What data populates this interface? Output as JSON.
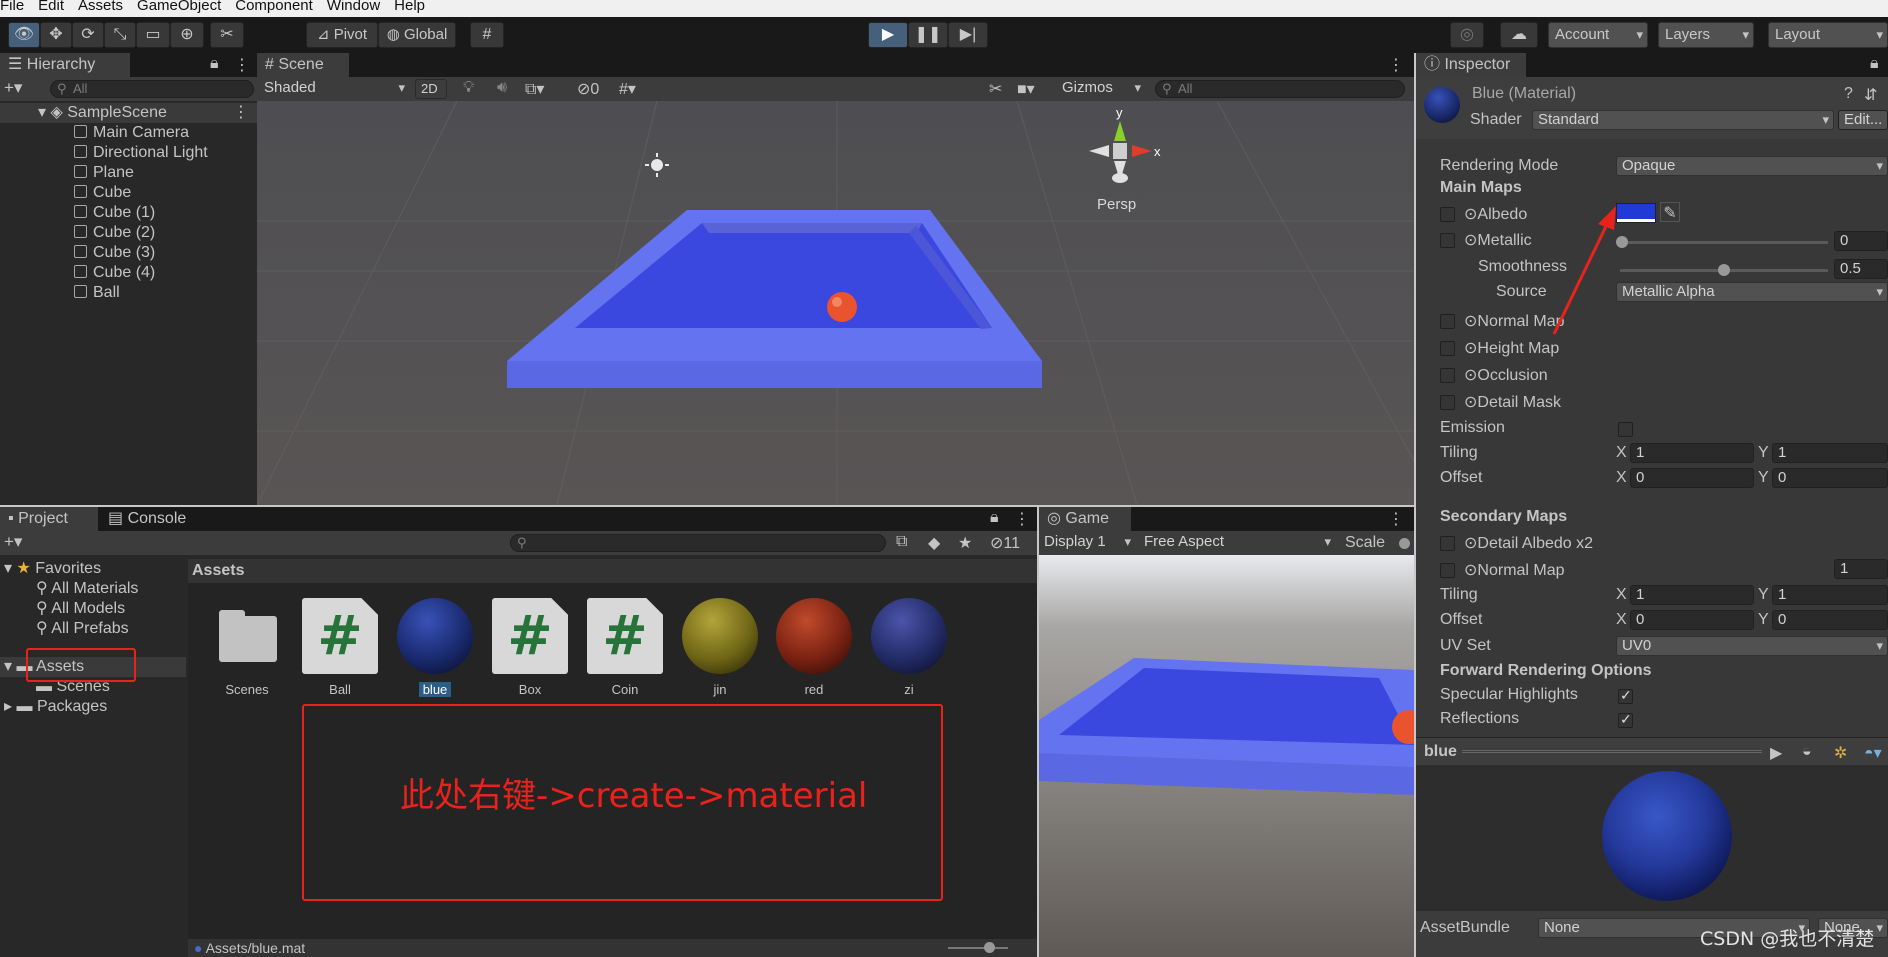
{
  "menu": [
    "File",
    "Edit",
    "Assets",
    "GameObject",
    "Component",
    "Window",
    "Help"
  ],
  "toolbar": {
    "pivot": "Pivot",
    "global": "Global",
    "account": "Account",
    "layers": "Layers",
    "layout": "Layout"
  },
  "hierarchy": {
    "tab": "Hierarchy",
    "search_placeholder": "All",
    "scene": "SampleScene",
    "items": [
      "Main Camera",
      "Directional Light",
      "Plane",
      "Cube",
      "Cube (1)",
      "Cube (2)",
      "Cube (3)",
      "Cube (4)",
      "Ball"
    ]
  },
  "scene": {
    "tab": "Scene",
    "shading": "Shaded",
    "mode2d": "2D",
    "hidden_count": "0",
    "gizmos": "Gizmos",
    "search_placeholder": "All",
    "persp": "Persp",
    "axis_x": "x",
    "axis_y": "y"
  },
  "project": {
    "tab": "Project",
    "console_tab": "Console",
    "badge_count": "11",
    "favorites": "Favorites",
    "fav_items": [
      "All Materials",
      "All Models",
      "All Prefabs"
    ],
    "assets_label": "Assets",
    "scenes_label": "Scenes",
    "packages_label": "Packages",
    "assets_header": "Assets",
    "assets": [
      {
        "name": "Scenes",
        "kind": "folder"
      },
      {
        "name": "Ball",
        "kind": "script"
      },
      {
        "name": "blue",
        "kind": "material",
        "color": "#1a2a6e"
      },
      {
        "name": "Box",
        "kind": "script"
      },
      {
        "name": "Coin",
        "kind": "script"
      },
      {
        "name": "jin",
        "kind": "material",
        "color": "#6f6616"
      },
      {
        "name": "red",
        "kind": "material",
        "color": "#7a2212"
      },
      {
        "name": "zi",
        "kind": "material",
        "color": "#232b66"
      }
    ],
    "annotation": "此处右键->create->material",
    "status_path": "Assets/blue.mat"
  },
  "game": {
    "tab": "Game",
    "display": "Display 1",
    "aspect": "Free Aspect",
    "scale": "Scale"
  },
  "inspector": {
    "tab": "Inspector",
    "title": "Blue (Material)",
    "shader_label": "Shader",
    "shader": "Standard",
    "edit": "Edit...",
    "rendering_mode_label": "Rendering Mode",
    "rendering_mode": "Opaque",
    "main_maps": "Main Maps",
    "albedo": "Albedo",
    "albedo_color": "#1f3ad6",
    "metallic": "Metallic",
    "metallic_value": "0",
    "smoothness": "Smoothness",
    "smoothness_value": "0.5",
    "source": "Source",
    "source_value": "Metallic Alpha",
    "normal_map": "Normal Map",
    "height_map": "Height Map",
    "occlusion": "Occlusion",
    "detail_mask": "Detail Mask",
    "emission": "Emission",
    "tiling": "Tiling",
    "offset": "Offset",
    "x": "X",
    "y": "Y",
    "tiling_x": "1",
    "tiling_y": "1",
    "offset_x": "0",
    "offset_y": "0",
    "secondary_maps": "Secondary Maps",
    "detail_albedo": "Detail Albedo x2",
    "normal_map2": "Normal Map",
    "normal_scale": "1",
    "tiling2_x": "1",
    "tiling2_y": "1",
    "offset2_x": "0",
    "offset2_y": "0",
    "uv_set": "UV Set",
    "uv_value": "UV0",
    "forward": "Forward Rendering Options",
    "specular": "Specular Highlights",
    "reflections": "Reflections",
    "preview_name": "blue",
    "assetbundle": "AssetBundle",
    "assetbundle_value": "None",
    "assetbundle_variant": "None"
  },
  "watermark": "CSDN @我也不清楚"
}
